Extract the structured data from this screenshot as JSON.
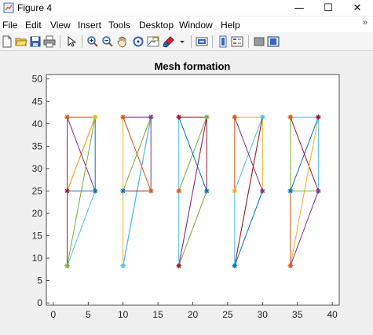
{
  "window": {
    "title": "Figure 4"
  },
  "controls": {
    "minimize": "—",
    "maximize": "☐",
    "close": "✕"
  },
  "menu": {
    "items": [
      "File",
      "Edit",
      "View",
      "Insert",
      "Tools",
      "Desktop",
      "Window",
      "Help"
    ]
  },
  "toolbar": {
    "icons": [
      "new-figure-icon",
      "open-file-icon",
      "save-icon",
      "print-icon",
      "pointer-icon",
      "zoom-in-icon",
      "zoom-out-icon",
      "pan-hand-icon",
      "rotate-3d-icon",
      "data-cursor-icon",
      "brush-icon",
      "brush-dropdown-icon",
      "link-plot-icon",
      "colorbar-icon",
      "legend-icon",
      "hide-plot-tools-icon",
      "show-plot-tools-icon"
    ]
  },
  "chart_data": {
    "type": "line",
    "title": "Mesh formation",
    "xlabel": "",
    "ylabel": "",
    "xlim": [
      -1,
      41
    ],
    "ylim": [
      -0.5,
      51
    ],
    "xticks": [
      0,
      5,
      10,
      15,
      20,
      25,
      30,
      35,
      40
    ],
    "yticks": [
      0,
      5,
      10,
      15,
      20,
      25,
      30,
      35,
      40,
      45,
      50
    ],
    "grid": false,
    "series": [
      {
        "color": "#0072BD",
        "x": [
          6,
          6,
          2
        ],
        "y": [
          41.5,
          25,
          25
        ]
      },
      {
        "color": "#D95319",
        "x": [
          2,
          6,
          2
        ],
        "y": [
          41.5,
          41.5,
          25
        ]
      },
      {
        "color": "#EDB120",
        "x": [
          2,
          6
        ],
        "y": [
          25,
          41.5
        ]
      },
      {
        "color": "#7E2F8E",
        "x": [
          2,
          6
        ],
        "y": [
          41.5,
          25
        ]
      },
      {
        "color": "#77AC30",
        "x": [
          2,
          6
        ],
        "y": [
          8.3,
          41.5
        ]
      },
      {
        "color": "#4DBEEE",
        "x": [
          2,
          6
        ],
        "y": [
          8.3,
          25
        ]
      },
      {
        "color": "#A2142F",
        "x": [
          2,
          2
        ],
        "y": [
          8.3,
          41.5
        ]
      },
      {
        "color": "#7E2F8E",
        "x": [
          10,
          14
        ],
        "y": [
          41.5,
          41.5
        ]
      },
      {
        "color": "#EDB120",
        "x": [
          10,
          10
        ],
        "y": [
          25,
          41.5
        ]
      },
      {
        "color": "#77AC30",
        "x": [
          10,
          14
        ],
        "y": [
          25,
          41.5
        ]
      },
      {
        "color": "#D95319",
        "x": [
          10,
          14
        ],
        "y": [
          41.5,
          25
        ]
      },
      {
        "color": "#0072BD",
        "x": [
          10,
          14
        ],
        "y": [
          8.3,
          41.5
        ]
      },
      {
        "color": "#4DBEEE",
        "x": [
          10,
          14
        ],
        "y": [
          8.3,
          41.5
        ]
      },
      {
        "color": "#A2142F",
        "x": [
          10,
          14
        ],
        "y": [
          25,
          25
        ]
      },
      {
        "color": "#EDB120",
        "x": [
          10,
          10
        ],
        "y": [
          8.3,
          25
        ]
      },
      {
        "color": "#7E2F8E",
        "x": [
          14,
          14
        ],
        "y": [
          25,
          41.5
        ]
      },
      {
        "color": "#A2142F",
        "x": [
          18,
          22
        ],
        "y": [
          41.5,
          41.5
        ]
      },
      {
        "color": "#4DBEEE",
        "x": [
          18,
          18
        ],
        "y": [
          25,
          41.5
        ]
      },
      {
        "color": "#77AC30",
        "x": [
          18,
          22
        ],
        "y": [
          25,
          41.5
        ]
      },
      {
        "color": "#0072BD",
        "x": [
          18,
          22
        ],
        "y": [
          41.5,
          25
        ]
      },
      {
        "color": "#D95319",
        "x": [
          18,
          22
        ],
        "y": [
          8.3,
          41.5
        ]
      },
      {
        "color": "#7E2F8E",
        "x": [
          18,
          22
        ],
        "y": [
          8.3,
          41.5
        ]
      },
      {
        "color": "#77AC30",
        "x": [
          18,
          22
        ],
        "y": [
          8.3,
          25
        ]
      },
      {
        "color": "#A2142F",
        "x": [
          22,
          22
        ],
        "y": [
          25,
          41.5
        ]
      },
      {
        "color": "#4DBEEE",
        "x": [
          18,
          18
        ],
        "y": [
          8.3,
          25
        ]
      },
      {
        "color": "#EDB120",
        "x": [
          26,
          30
        ],
        "y": [
          41.5,
          41.5
        ]
      },
      {
        "color": "#D95319",
        "x": [
          26,
          26
        ],
        "y": [
          25,
          41.5
        ]
      },
      {
        "color": "#4DBEEE",
        "x": [
          26,
          30
        ],
        "y": [
          25,
          41.5
        ]
      },
      {
        "color": "#7E2F8E",
        "x": [
          26,
          30
        ],
        "y": [
          41.5,
          25
        ]
      },
      {
        "color": "#77AC30",
        "x": [
          26,
          30
        ],
        "y": [
          8.3,
          41.5
        ]
      },
      {
        "color": "#A2142F",
        "x": [
          26,
          30
        ],
        "y": [
          8.3,
          41.5
        ]
      },
      {
        "color": "#0072BD",
        "x": [
          26,
          30
        ],
        "y": [
          8.3,
          25
        ]
      },
      {
        "color": "#EDB120",
        "x": [
          30,
          30
        ],
        "y": [
          25,
          41.5
        ]
      },
      {
        "color": "#4DBEEE",
        "x": [
          26,
          26
        ],
        "y": [
          8.3,
          25
        ]
      },
      {
        "color": "#4DBEEE",
        "x": [
          34,
          38
        ],
        "y": [
          41.5,
          41.5
        ]
      },
      {
        "color": "#77AC30",
        "x": [
          34,
          34
        ],
        "y": [
          25,
          41.5
        ]
      },
      {
        "color": "#0072BD",
        "x": [
          34,
          38
        ],
        "y": [
          25,
          41.5
        ]
      },
      {
        "color": "#A2142F",
        "x": [
          34,
          38
        ],
        "y": [
          41.5,
          25
        ]
      },
      {
        "color": "#EDB120",
        "x": [
          34,
          38
        ],
        "y": [
          8.3,
          41.5
        ]
      },
      {
        "color": "#7E2F8E",
        "x": [
          34,
          38
        ],
        "y": [
          8.3,
          25
        ]
      },
      {
        "color": "#77AC30",
        "x": [
          34,
          38
        ],
        "y": [
          25,
          25
        ]
      },
      {
        "color": "#4DBEEE",
        "x": [
          38,
          38
        ],
        "y": [
          25,
          41.5
        ]
      },
      {
        "color": "#D95319",
        "x": [
          34,
          34
        ],
        "y": [
          8.3,
          25
        ]
      }
    ],
    "markers": [
      {
        "x": 2,
        "y": 41.5,
        "color": "#D95319"
      },
      {
        "x": 6,
        "y": 41.5,
        "color": "#EDB120"
      },
      {
        "x": 2,
        "y": 25,
        "color": "#A2142F"
      },
      {
        "x": 6,
        "y": 25,
        "color": "#0072BD"
      },
      {
        "x": 2,
        "y": 8.3,
        "color": "#77AC30"
      },
      {
        "x": 10,
        "y": 41.5,
        "color": "#D95319"
      },
      {
        "x": 14,
        "y": 41.5,
        "color": "#7E2F8E"
      },
      {
        "x": 10,
        "y": 25,
        "color": "#0072BD"
      },
      {
        "x": 14,
        "y": 25,
        "color": "#D95319"
      },
      {
        "x": 10,
        "y": 8.3,
        "color": "#4DBEEE"
      },
      {
        "x": 18,
        "y": 41.5,
        "color": "#A2142F"
      },
      {
        "x": 22,
        "y": 41.5,
        "color": "#77AC30"
      },
      {
        "x": 18,
        "y": 25,
        "color": "#D95319"
      },
      {
        "x": 22,
        "y": 25,
        "color": "#0072BD"
      },
      {
        "x": 18,
        "y": 8.3,
        "color": "#A2142F"
      },
      {
        "x": 26,
        "y": 41.5,
        "color": "#D95319"
      },
      {
        "x": 30,
        "y": 41.5,
        "color": "#4DBEEE"
      },
      {
        "x": 26,
        "y": 25,
        "color": "#EDB120"
      },
      {
        "x": 30,
        "y": 25,
        "color": "#7E2F8E"
      },
      {
        "x": 26,
        "y": 8.3,
        "color": "#0072BD"
      },
      {
        "x": 34,
        "y": 41.5,
        "color": "#D95319"
      },
      {
        "x": 38,
        "y": 41.5,
        "color": "#A2142F"
      },
      {
        "x": 34,
        "y": 25,
        "color": "#0072BD"
      },
      {
        "x": 38,
        "y": 25,
        "color": "#7E2F8E"
      },
      {
        "x": 34,
        "y": 8.3,
        "color": "#D95319"
      }
    ]
  }
}
